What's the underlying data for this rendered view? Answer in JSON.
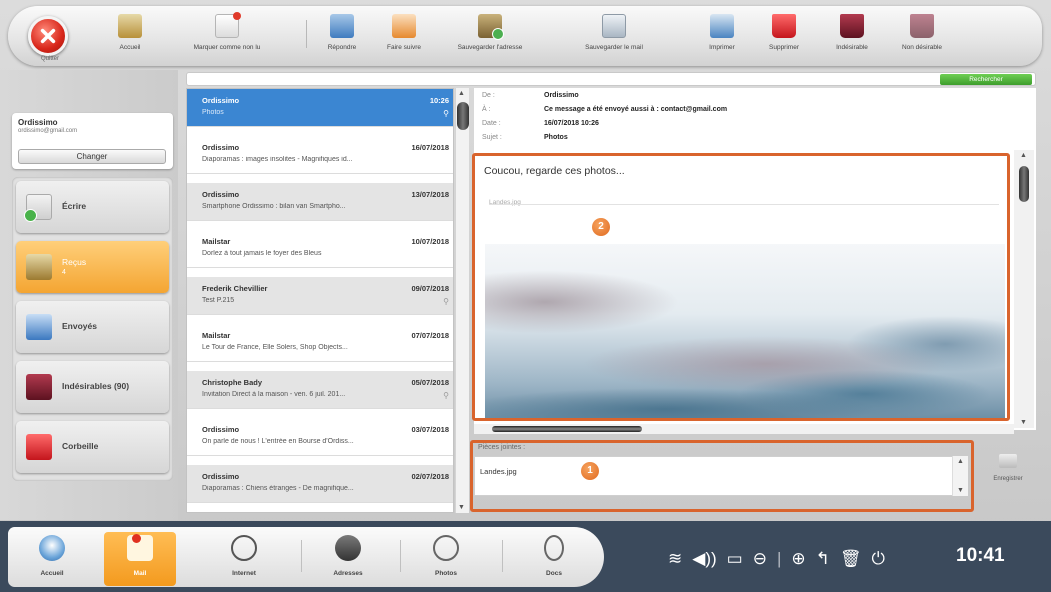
{
  "toolbar": {
    "quit_label": "Quitter",
    "items": [
      {
        "label": "Accueil"
      },
      {
        "label": "Marquer comme non lu"
      },
      {
        "label": "Répondre"
      },
      {
        "label": "Faire suivre"
      },
      {
        "label": "Sauvegarder l'adresse"
      },
      {
        "label": "Sauvegarder le mail"
      },
      {
        "label": "Imprimer"
      },
      {
        "label": "Supprimer"
      },
      {
        "label": "Indésirable"
      },
      {
        "label": "Non désirable"
      }
    ]
  },
  "search": {
    "label": "Rechercher"
  },
  "account": {
    "name": "Ordissimo",
    "email": "ordissimo@gmail.com",
    "change_label": "Changer"
  },
  "folders": [
    {
      "label": "Écrire"
    },
    {
      "label": "Reçus",
      "count": "4"
    },
    {
      "label": "Envoyés"
    },
    {
      "label": "Indésirables (90)"
    },
    {
      "label": "Corbeille"
    }
  ],
  "messages": [
    {
      "from": "Ordissimo",
      "date": "10:26",
      "subject": "Photos"
    },
    {
      "from": "Ordissimo",
      "date": "16/07/2018",
      "subject": "Diaporamas : images insolites - Magnifiques id..."
    },
    {
      "from": "Ordissimo",
      "date": "13/07/2018",
      "subject": "Smartphone Ordissimo : bilan van Smartpho..."
    },
    {
      "from": "Mailstar",
      "date": "10/07/2018",
      "subject": "Dorlez à tout jamais le foyer des Bleus"
    },
    {
      "from": "Frederik Chevillier",
      "date": "09/07/2018",
      "subject": "Test P.215"
    },
    {
      "from": "Mailstar",
      "date": "07/07/2018",
      "subject": "Le Tour de France, Elle Solers, Shop Objects..."
    },
    {
      "from": "Christophe Bady",
      "date": "05/07/2018",
      "subject": "Invitation Direct à la maison - ven. 6 juil. 201..."
    },
    {
      "from": "Ordissimo",
      "date": "03/07/2018",
      "subject": "On parle de nous ! L'entrée en Bourse d'Ordiss..."
    },
    {
      "from": "Ordissimo",
      "date": "02/07/2018",
      "subject": "Diaporamas : Chiens étranges - De magnifique..."
    }
  ],
  "message_header": {
    "from_key": "De :",
    "from": "Ordissimo",
    "to_key": "À :",
    "to": "Ce message a été envoyé aussi à : contact@gmail.com",
    "date_key": "Date :",
    "date": "16/07/2018 10:26",
    "subject_key": "Sujet :",
    "subject": "Photos"
  },
  "content": {
    "greeting": "Coucou, regarde ces photos...",
    "inline_attachment": "Landes.jpg"
  },
  "attachments": {
    "label": "Pièces jointes :",
    "files": [
      "Landes.jpg"
    ],
    "save_label": "Enregistrer"
  },
  "badges": {
    "one": "1",
    "two": "2"
  },
  "dock": [
    {
      "label": "Accueil"
    },
    {
      "label": "Mail"
    },
    {
      "label": "Internet"
    },
    {
      "label": "Adresses"
    },
    {
      "label": "Photos"
    },
    {
      "label": "Docs"
    }
  ],
  "status": {
    "time": "10:41"
  },
  "colors": {
    "accent_orange": "#f4a532",
    "selected_blue": "#3b86d2",
    "annotation": "#d9642d"
  }
}
